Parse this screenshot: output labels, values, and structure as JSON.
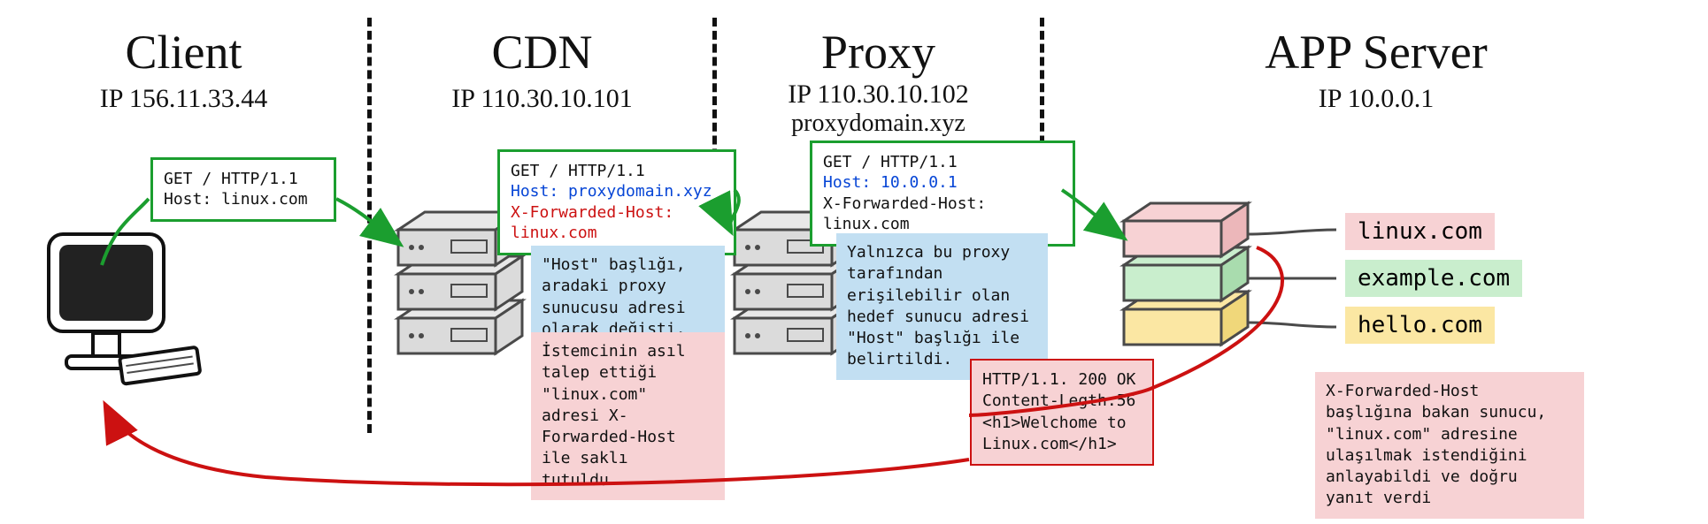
{
  "columns": {
    "client": {
      "title": "Client",
      "ip": "IP 156.11.33.44"
    },
    "cdn": {
      "title": "CDN",
      "ip": "IP 110.30.10.101"
    },
    "proxy": {
      "title": "Proxy",
      "ip": "IP 110.30.10.102",
      "domain": "proxydomain.xyz"
    },
    "app": {
      "title": "APP Server",
      "ip": "IP 10.0.0.1"
    }
  },
  "requests": {
    "client": {
      "line1": "GET /  HTTP/1.1",
      "line2": "Host: linux.com"
    },
    "cdn": {
      "line1": "GET /  HTTP/1.1",
      "line2": "Host: proxydomain.xyz",
      "line3": "X-Forwarded-Host: linux.com"
    },
    "proxy": {
      "line1": "GET /  HTTP/1.1",
      "line2": "Host: 10.0.0.1",
      "line3": "X-Forwarded-Host: linux.com"
    }
  },
  "notes": {
    "cdn_blue": "\"Host\" başlığı, aradaki proxy sunucusu adresi olarak değişti.",
    "cdn_pink": "İstemcinin asıl talep ettiği \"linux.com\" adresi X-Forwarded-Host ile saklı tutuldu.",
    "proxy_blue": "Yalnızca bu proxy tarafından erişilebilir olan hedef sunucu adresi \"Host\" başlığı ile belirtildi.",
    "app_pink": "X-Forwarded-Host başlığına bakan sunucu, \"linux.com\" adresine ulaşılmak istendiğini anlayabildi ve doğru yanıt verdi"
  },
  "response": {
    "line1": "HTTP/1.1. 200 OK",
    "line2": "Content-Legth:56",
    "line3": "",
    "line4": "<h1>Welchome to Linux.com</h1>"
  },
  "vhosts": {
    "a": "linux.com",
    "b": "example.com",
    "c": "hello.com"
  }
}
